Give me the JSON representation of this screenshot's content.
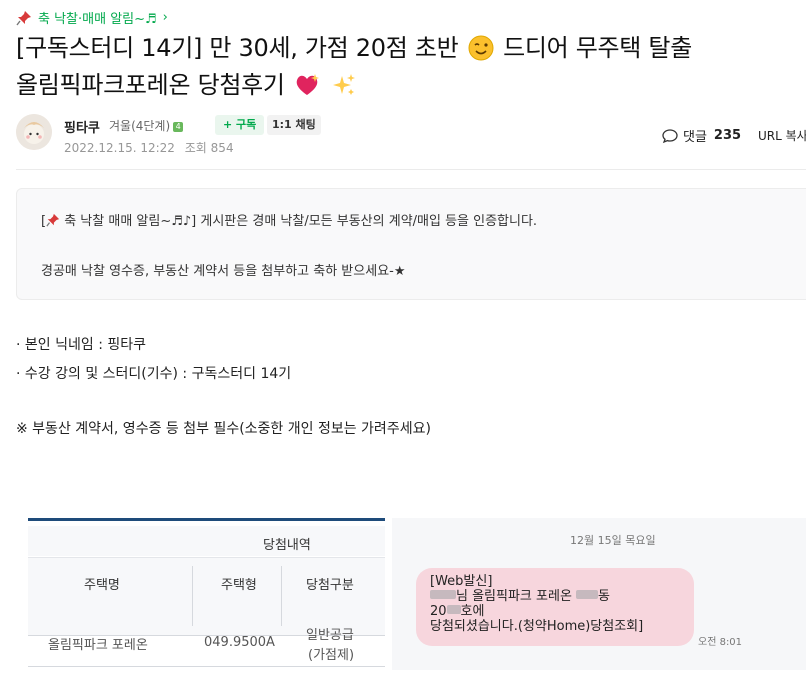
{
  "board": {
    "label": "축 낙찰·매매 알림~♬",
    "chevron": "›"
  },
  "post": {
    "title_line1": "[구독스터디 14기] 만 30세, 가점 20점 초반",
    "title_line1_b": " 드디어 무주택 탈출",
    "title_line2": "올림픽파크포레온 당첨후기",
    "title_emojis": [
      "winking-face",
      "sparkling-heart",
      "sparkles"
    ]
  },
  "author": {
    "nickname": "핑타쿠",
    "grade": "겨울(4단계)",
    "grade_badge": "4",
    "subscribe_label": "+ 구독",
    "chat_label": "1:1 채팅",
    "date": "2022.12.15. 12:22",
    "views_label": "조회",
    "views": "854"
  },
  "actions": {
    "comments_label": "댓글",
    "comments_count": "235",
    "url_copy": "URL 복사"
  },
  "notice": {
    "line1_open": "[",
    "line1_board": " 축 낙찰 매매 알림~♬♪]",
    "line1_rest": " 게시판은 경매 낙찰/모든 부동산의 계약/매입 등을 인증합니다.",
    "line2": "경공매 낙찰 영수증, 부동산 계약서 등을 첨부하고 축하 받으세요-★"
  },
  "content": {
    "nickname_line": "· 본인 닉네임 :  핑타쿠",
    "study_line": "· 수강 강의 및 스터디(기수) :  구독스터디 14기",
    "warning_line": "※ 부동산 계약서, 영수증 등 첨부 필수(소중한 개인 정보는 가려주세요)"
  },
  "result_table": {
    "title": "당첨내역",
    "headers": [
      "주택명",
      "주택형",
      "당첨구분"
    ],
    "row": {
      "name": "올림픽파크 포레온",
      "type": "049.9500A",
      "category_line1": "일반공급",
      "category_line2": "(가점제)"
    }
  },
  "sms": {
    "date": "12월 15일 목요일",
    "line1": "[Web발신]",
    "line2_suffix": "님 올림픽파크 포레온 ",
    "line2_unit": "동",
    "line3_prefix": "20",
    "line3_suffix": "호에",
    "line4": "당첨되셨습니다.(청약Home)당첨조회]",
    "time": "오전 8:01"
  },
  "colors": {
    "accent_green": "#03a94d",
    "table_top": "#1e4b7a",
    "bubble": "#f7d6dd"
  },
  "icons": {
    "pin": "pushpin-icon",
    "comment": "comment-bubble-icon",
    "avatar": "profile-avatar"
  }
}
